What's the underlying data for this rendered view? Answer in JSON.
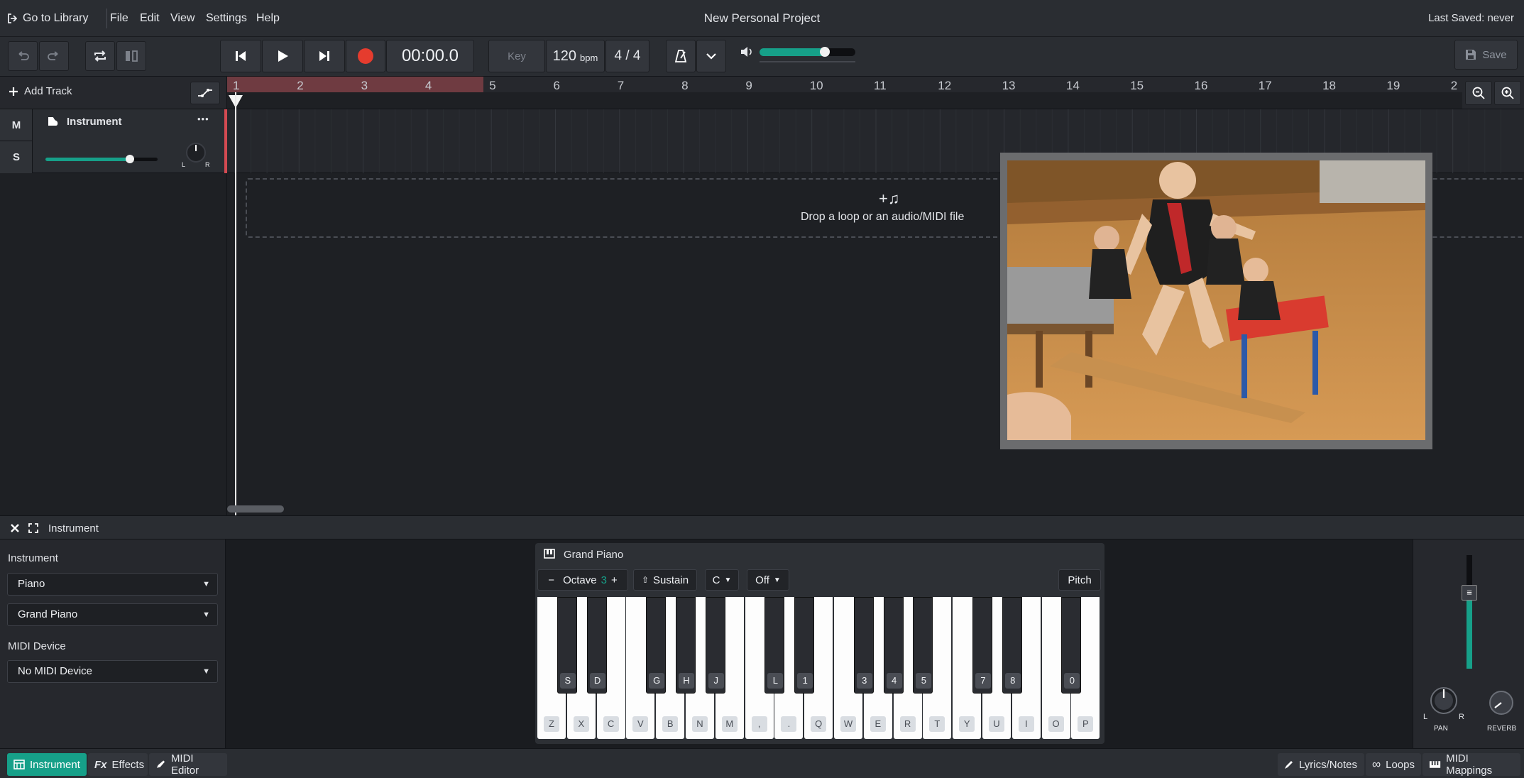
{
  "menubar": {
    "library_label": "Go to Library",
    "menus": [
      "File",
      "Edit",
      "View",
      "Settings",
      "Help"
    ],
    "project_title": "New Personal Project",
    "last_saved": "Last Saved: never"
  },
  "transport": {
    "time": "00:00.0",
    "key_label": "Key",
    "tempo": "120",
    "tempo_unit": "bpm",
    "time_signature": "4 / 4",
    "volume_level": 0.68,
    "save_label": "Save"
  },
  "tracks_header": {
    "add_track_label": "Add Track",
    "bar_numbers": [
      "1",
      "2",
      "3",
      "4",
      "5",
      "6",
      "7",
      "8",
      "9",
      "10",
      "11",
      "12",
      "13",
      "14",
      "15",
      "16",
      "17",
      "18",
      "19",
      "2"
    ],
    "loop_region_bars": [
      1,
      5
    ]
  },
  "track": {
    "mute_label": "M",
    "solo_label": "S",
    "name": "Instrument",
    "more_label": "•••",
    "volume_level": 0.75,
    "pan_left": "L",
    "pan_right": "R"
  },
  "dropzone": {
    "icon_text": "+♫",
    "text": "Drop a loop or an audio/MIDI file"
  },
  "panel": {
    "title": "Instrument",
    "instrument_label": "Instrument",
    "instrument_value": "Piano",
    "preset_value": "Grand Piano",
    "midi_device_label": "MIDI Device",
    "midi_device_value": "No MIDI Device"
  },
  "piano": {
    "title": "Grand Piano",
    "octave_minus": "−",
    "octave_label": "Octave",
    "octave_value": "3",
    "octave_plus": "+",
    "sustain_label": "Sustain",
    "key_value": "C",
    "off_value": "Off",
    "pitch_label": "Pitch",
    "white_keys": [
      "Z",
      "X",
      "C",
      "V",
      "B",
      "N",
      "M",
      ",",
      ".",
      "Q",
      "W",
      "E",
      "R",
      "T",
      "Y",
      "U",
      "I",
      "O",
      "P"
    ],
    "black_keys": [
      "S",
      "D",
      "G",
      "H",
      "J",
      "L",
      "1",
      "3",
      "4",
      "5",
      "7",
      "8",
      "0"
    ]
  },
  "mixer": {
    "pan_label": "PAN",
    "reverb_label": "REVERB",
    "pan_l": "L",
    "pan_r": "R",
    "fader_level": 0.6
  },
  "tabs": {
    "instrument": "Instrument",
    "effects": "Effects",
    "effects_prefix": "Fx",
    "midi_editor": "MIDI Editor",
    "lyrics": "Lyrics/Notes",
    "loops": "Loops",
    "midi_mappings": "MIDI Mappings"
  },
  "colors": {
    "accent": "#16a089",
    "record": "#e53c2e",
    "track_marker": "#d34a52"
  },
  "icons": [
    "library-icon",
    "undo-icon",
    "redo-icon",
    "loop-icon",
    "split-icon",
    "skip-back-icon",
    "play-icon",
    "skip-forward-icon",
    "record-icon",
    "metronome-icon",
    "chevron-down-icon",
    "volume-icon",
    "save-icon",
    "plus-icon",
    "automation-icon",
    "zoom-out-icon",
    "zoom-in-icon",
    "instrument-icon",
    "close-icon",
    "expand-icon",
    "piano-icon",
    "music-note-icon",
    "pencil-icon",
    "infinity-icon",
    "keyboard-icon"
  ]
}
